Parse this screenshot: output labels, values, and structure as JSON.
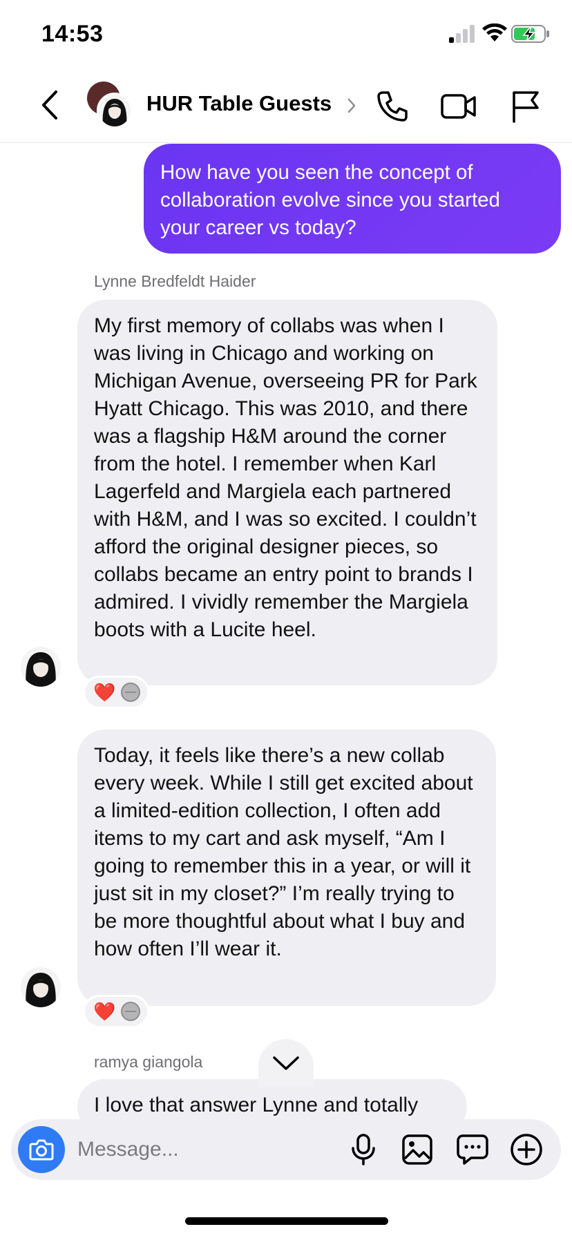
{
  "status_bar": {
    "time": "14:53",
    "signal_icon": "cellular-signal-icon",
    "wifi_icon": "wifi-icon",
    "battery_icon": "battery-charging-icon"
  },
  "header": {
    "title": "HUR Table Guests",
    "back_icon": "chevron-left-icon",
    "title_chevron_icon": "chevron-right-icon",
    "call_icon": "phone-icon",
    "video_icon": "video-camera-icon",
    "report_icon": "flag-icon"
  },
  "messages": [
    {
      "direction": "outgoing",
      "text": "How have you seen the concept of collaboration evolve since you started your career vs today?"
    },
    {
      "direction": "incoming",
      "sender": "Lynne Bredfeldt Haider",
      "text": "My first memory of collabs was when I was living in Chicago and working on Michigan Avenue, overseeing PR for Park Hyatt Chicago. This was 2010, and there was a flagship H&M around the corner from the hotel. I remember when Karl Lagerfeld and Margiela each partnered with H&M, and I was so excited. I couldn’t afford the original designer pieces, so collabs became an entry point to brands I admired. I vividly remember the Margiela boots with a Lucite heel.",
      "reactions": [
        "❤️",
        "neutral-face"
      ]
    },
    {
      "direction": "incoming",
      "text": "Today, it feels like there’s a new collab every week. While I still get excited about a limited-edition collection, I often add items to my cart and ask myself, “Am I going to remember this in a year, or will it just sit in my closet?” I’m really trying to be more thoughtful about what I buy and how often I’ll wear it.",
      "reactions": [
        "❤️",
        "neutral-face"
      ]
    },
    {
      "direction": "incoming",
      "sender": "ramya giangola",
      "text": "I love that answer Lynne and totally"
    }
  ],
  "composer": {
    "placeholder": "Message...",
    "camera_icon": "camera-icon",
    "mic_icon": "microphone-icon",
    "gallery_icon": "image-icon",
    "sticker_icon": "chat-bubble-icon",
    "add_icon": "plus-circle-icon"
  },
  "colors": {
    "outgoing_bubble": "#6a35f2",
    "incoming_bubble": "#efeff3",
    "camera_button": "#2f7bf6"
  }
}
